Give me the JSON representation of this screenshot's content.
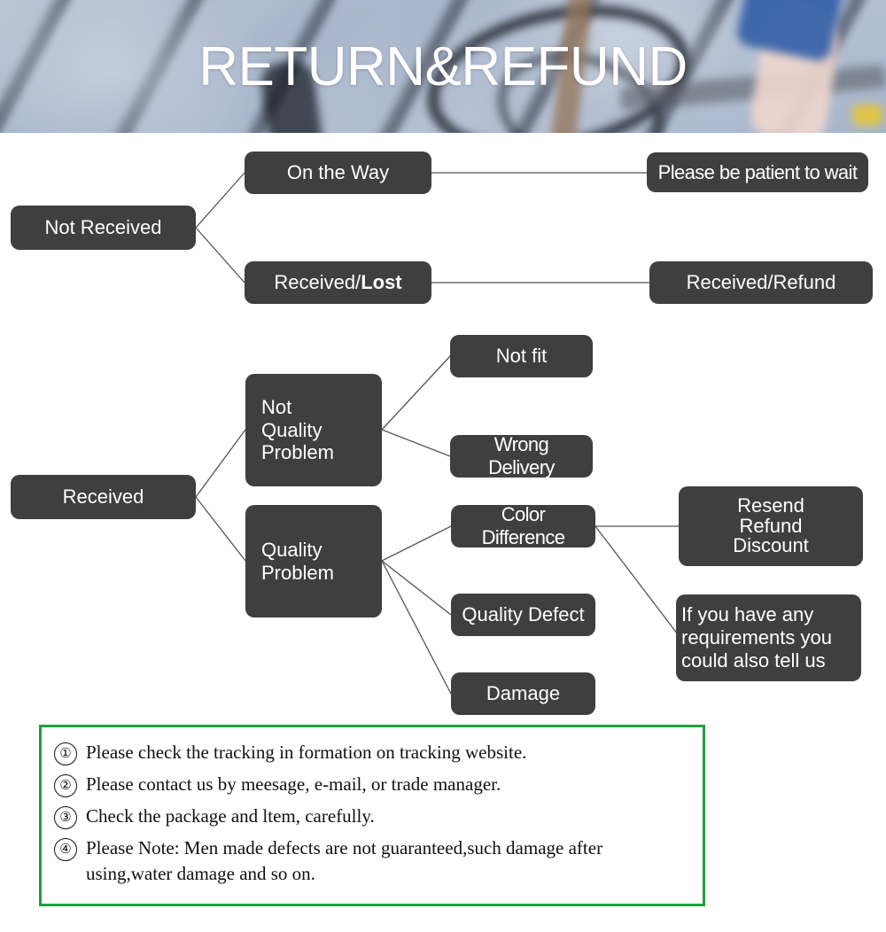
{
  "banner": {
    "title": "RETURN&REFUND",
    "background_description": "blurred photo of wooden deck boards with a bicycle and a person's legs in denim shorts",
    "title_color": "#ffffff"
  },
  "theme": {
    "node_fill": "#3f3f3f",
    "node_text": "#ffffff",
    "connector_color": "#555555",
    "notes_border": "#1fa040",
    "page_background": "#ffffff"
  },
  "flowchart": {
    "type": "tree",
    "nodes": {
      "not_received": "Not Received",
      "on_the_way": "On the Way",
      "received_lost_prefix": "Received/",
      "received_lost_bold": "Lost",
      "please_be_patient": "Please be patient to wait",
      "received_refund": "Received/Refund",
      "received": "Received",
      "not_quality_problem": "Not\nQuality\nProblem",
      "quality_problem": "Quality\nProblem",
      "not_fit": "Not fit",
      "wrong_delivery": "Wrong Delivery",
      "color_difference": "Color Difference",
      "quality_defect": "Quality Defect",
      "damage": "Damage",
      "resend_refund_discount": "Resend\nRefund\nDiscount",
      "if_you_have_any": "If you have any\nrequirements you\ncould also tell us"
    },
    "edges": [
      [
        "not_received",
        "on_the_way"
      ],
      [
        "not_received",
        "received_lost"
      ],
      [
        "on_the_way",
        "please_be_patient"
      ],
      [
        "received_lost",
        "received_refund"
      ],
      [
        "received",
        "not_quality_problem"
      ],
      [
        "received",
        "quality_problem"
      ],
      [
        "not_quality_problem",
        "not_fit"
      ],
      [
        "not_quality_problem",
        "wrong_delivery"
      ],
      [
        "quality_problem",
        "color_difference"
      ],
      [
        "quality_problem",
        "quality_defect"
      ],
      [
        "quality_problem",
        "damage"
      ],
      [
        "color_difference",
        "resend_refund_discount"
      ],
      [
        "color_difference",
        "if_you_have_any"
      ]
    ]
  },
  "notes": {
    "items": [
      {
        "num": "①",
        "text": "Please check the tracking in formation on tracking website."
      },
      {
        "num": "②",
        "text": "Please contact us by meesage, e-mail, or trade manager."
      },
      {
        "num": "③",
        "text": "Check the package and ltem, carefully."
      },
      {
        "num": "④",
        "text": "Please Note: Men made defects  are not guaranteed,such damage after using,water damage and so on."
      }
    ]
  }
}
